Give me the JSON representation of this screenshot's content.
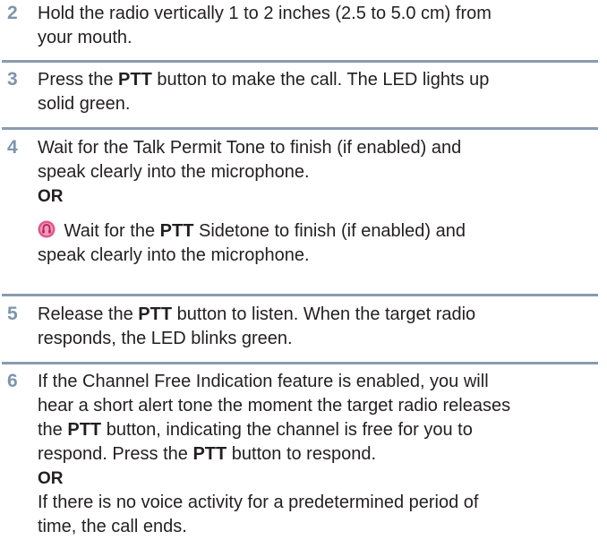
{
  "steps": [
    {
      "number": "2",
      "lines": [
        "Hold the radio vertically 1 to 2 inches (2.5 to 5.0 cm) from",
        "your mouth."
      ]
    },
    {
      "number": "3",
      "line1_pre": "Press the ",
      "line1_bold": "PTT",
      "line1_post": " button to make the call. The LED lights up",
      "line2": "solid green."
    },
    {
      "number": "4",
      "lines": [
        "Wait for the Talk Permit Tone to finish (if enabled) and",
        "speak clearly into the microphone."
      ],
      "or": "OR",
      "alt_pre": " Wait for the ",
      "alt_bold": "PTT",
      "alt_post": " Sidetone to finish (if enabled) and",
      "alt_line2": "speak clearly into the microphone.",
      "alt_icon": "ptt-sidetone-icon"
    },
    {
      "number": "5",
      "line1_pre": "Release the ",
      "line1_bold": "PTT",
      "line1_post": " button to listen. When the target radio",
      "line2": "responds, the LED blinks green."
    },
    {
      "number": "6",
      "line1": "If the Channel Free Indication feature is enabled, you will",
      "line2": "hear a short alert tone the moment the target radio releases",
      "line3_pre": "the ",
      "line3_bold": "PTT",
      "line3_post": " button, indicating the channel is free for you to",
      "line4_pre": "respond. Press the ",
      "line4_bold": "PTT",
      "line4_post": " button to respond.",
      "or": "OR",
      "line5": "If there is no voice activity for a predetermined period of",
      "line6": "time, the call ends."
    }
  ],
  "colors": {
    "step_number": "#7d95ad",
    "divider": "#8a9bb1",
    "text": "#231f20",
    "icon": "#e0578f"
  }
}
